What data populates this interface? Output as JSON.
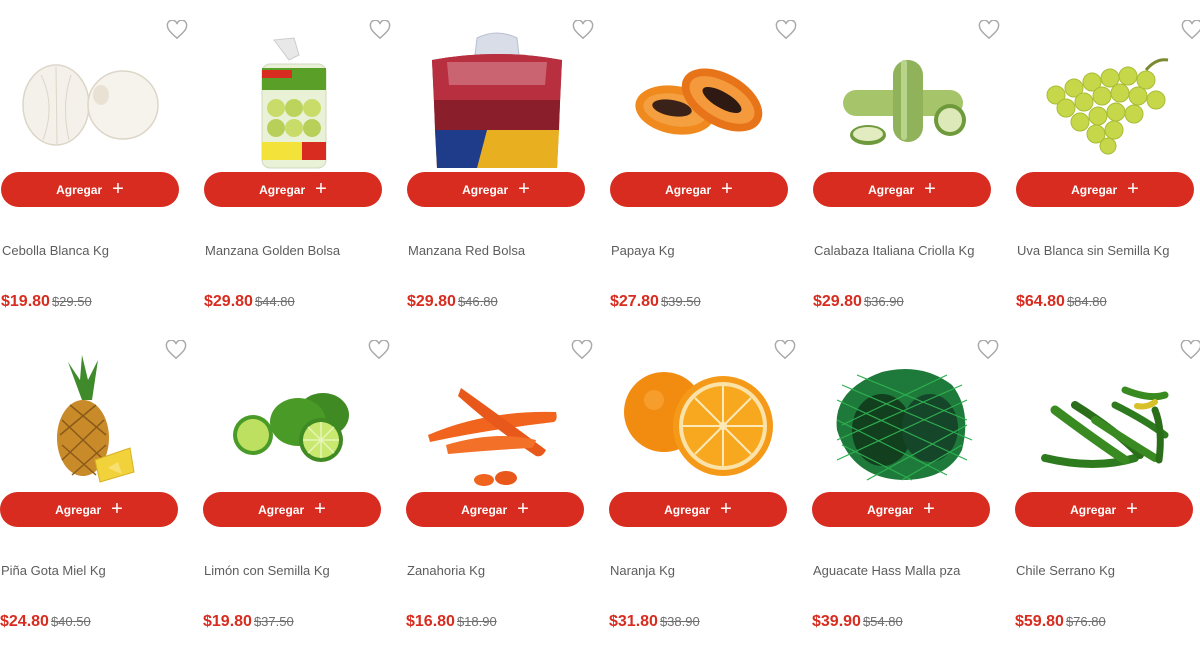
{
  "colors": {
    "accent": "#d72c1f",
    "text": "#5d5d5d",
    "old_price": "#6f6f6f"
  },
  "add_label": "Agregar",
  "products": [
    {
      "name": "Cebolla Blanca Kg",
      "price": "$19.80",
      "old_price": "$29.50",
      "icon": "onion-image"
    },
    {
      "name": "Manzana Golden Bolsa",
      "price": "$29.80",
      "old_price": "$44.80",
      "icon": "golden-apple-bag-image"
    },
    {
      "name": "Manzana Red Bolsa",
      "price": "$29.80",
      "old_price": "$46.80",
      "icon": "red-apple-bag-image"
    },
    {
      "name": "Papaya Kg",
      "price": "$27.80",
      "old_price": "$39.50",
      "icon": "papaya-image"
    },
    {
      "name": "Calabaza Italiana Criolla Kg",
      "price": "$29.80",
      "old_price": "$36.90",
      "icon": "zucchini-image"
    },
    {
      "name": "Uva Blanca sin Semilla Kg",
      "price": "$64.80",
      "old_price": "$84.80",
      "icon": "white-grape-image"
    },
    {
      "name": "Piña Gota Miel Kg",
      "price": "$24.80",
      "old_price": "$40.50",
      "icon": "pineapple-image"
    },
    {
      "name": "Limón con Semilla Kg",
      "price": "$19.80",
      "old_price": "$37.50",
      "icon": "lime-image"
    },
    {
      "name": "Zanahoria Kg",
      "price": "$16.80",
      "old_price": "$18.90",
      "icon": "carrot-image"
    },
    {
      "name": "Naranja Kg",
      "price": "$31.80",
      "old_price": "$38.90",
      "icon": "orange-image"
    },
    {
      "name": "Aguacate Hass Malla pza",
      "price": "$39.90",
      "old_price": "$54.80",
      "icon": "avocado-mesh-image"
    },
    {
      "name": "Chile Serrano Kg",
      "price": "$59.80",
      "old_price": "$76.80",
      "icon": "serrano-pepper-image"
    }
  ]
}
